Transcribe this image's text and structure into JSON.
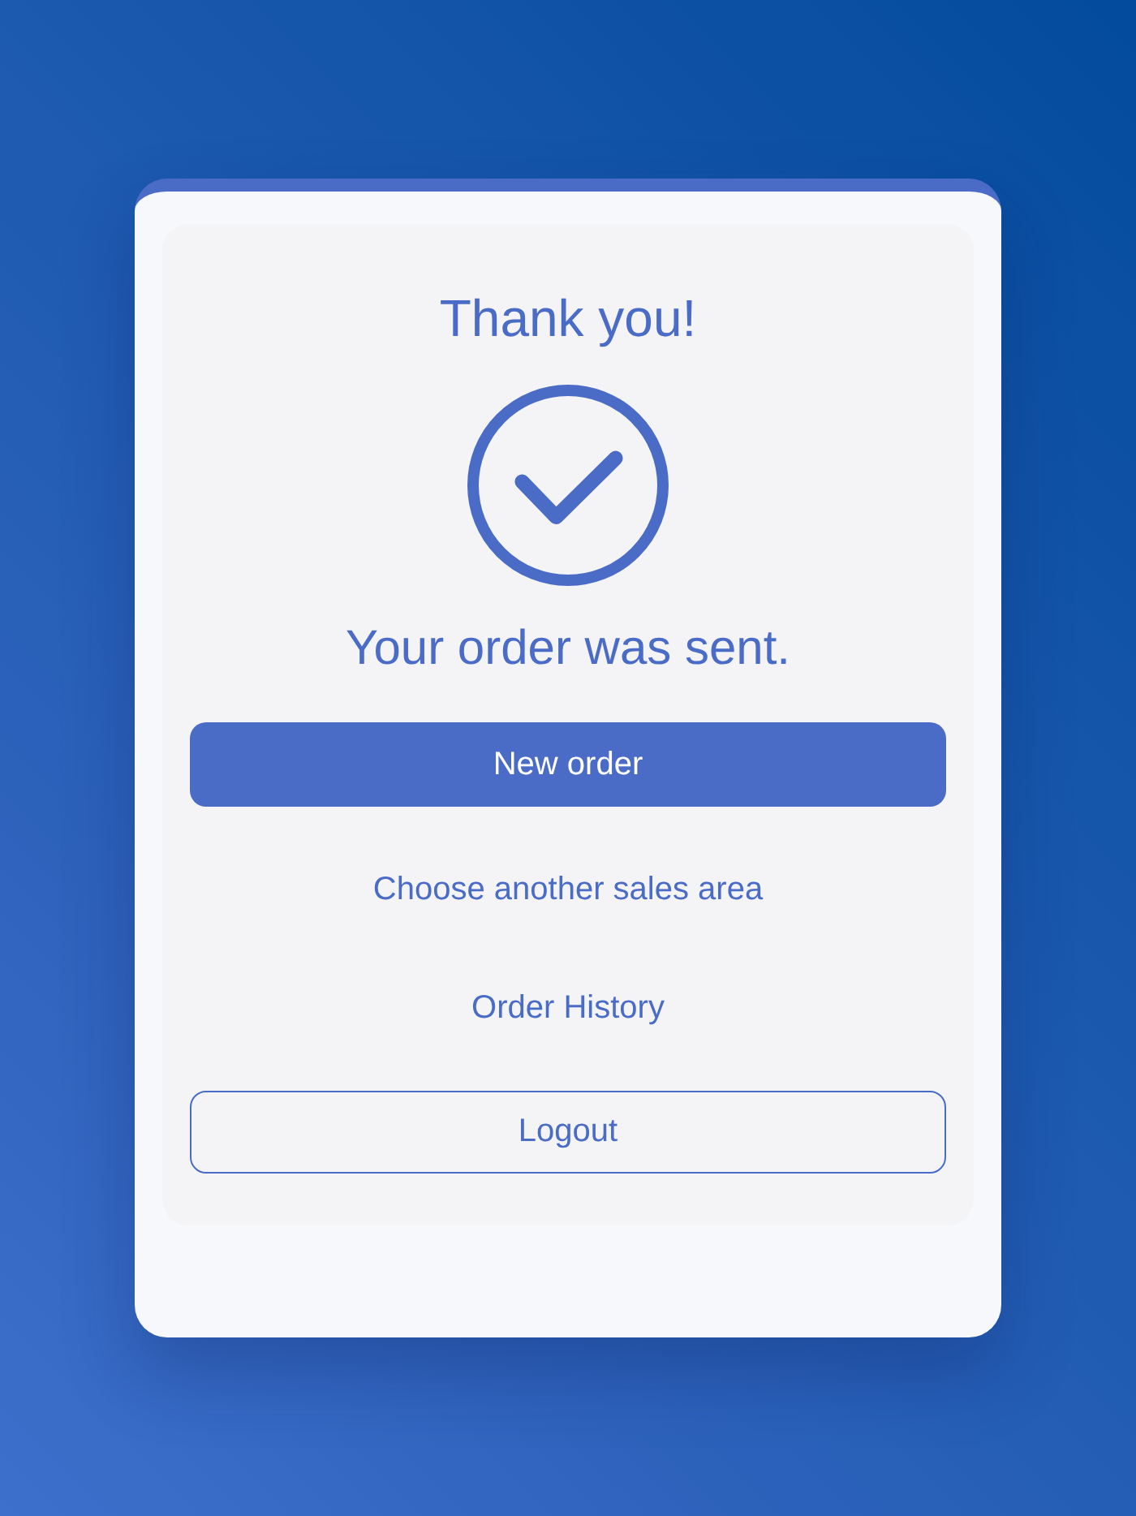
{
  "confirmation": {
    "title": "Thank you!",
    "message": "Your order was sent."
  },
  "actions": [
    {
      "label": "New order",
      "kind": "primary"
    },
    {
      "label": "Choose another sales area",
      "kind": "link"
    },
    {
      "label": "Order History",
      "kind": "link"
    },
    {
      "label": "Logout",
      "kind": "outline"
    }
  ]
}
